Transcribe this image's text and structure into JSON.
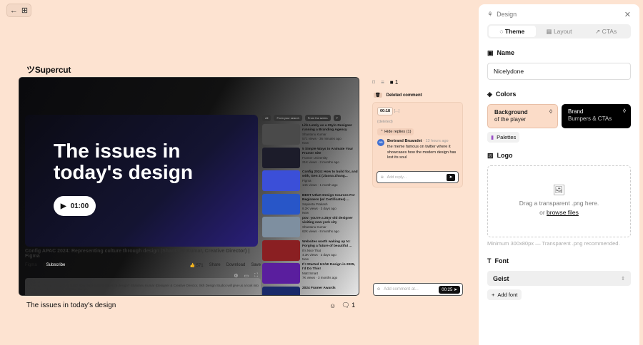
{
  "topbar": {
    "back_icon": "←",
    "grid_icon": "⊞"
  },
  "brand": {
    "logo_mark": "ツ",
    "name": "Supercut"
  },
  "video": {
    "title_overlay": "The issues in today's design",
    "play_time": "01:00",
    "yt_title": "Config APAC 2024: Representing culture through design (Shantanu Kumar, Creative Director) | Figma",
    "channel": "Figma",
    "subscribe": "Subscribe",
    "likes": "571",
    "share": "Share",
    "download": "Download",
    "save": "Save",
    "views": "8K views  4 months ago",
    "description": "How does design influence culture? How does culture influence design? Shantanu Kumar (Designer & Creative Director, Skh Design Studio) will give us a look into the details of the craft behind great design.",
    "more": "...more",
    "chips": [
      "All",
      "From your search",
      "From the series",
      "F"
    ],
    "related": [
      {
        "title": "Life Lately as a 25y/o Designer running a Branding Agency",
        "channel": "Shantanu Kumar",
        "meta": "571 views · 36 minutes ago",
        "badge": "New",
        "dur": "14:10",
        "color": "#4a4a4a"
      },
      {
        "title": "5 Simple Ways to Animate Your Framer Site",
        "channel": "Framer University",
        "meta": "21K views · 2 months ago",
        "badge": "",
        "dur": "14:41",
        "color": "#1c1c2a"
      },
      {
        "title": "Config 2024: How to build for, and with, Gen Z (Jiaona Zhang...",
        "channel": "Figma",
        "meta": "14K views · 1 month ago",
        "badge": "",
        "dur": "23:15",
        "color": "#3b4fd8"
      },
      {
        "title": "BEST UI/UX Design Courses For Beginners (w/ Certificates) ...",
        "channel": "Sapienta Prakash",
        "meta": "8.2K views · 3 days ago",
        "badge": "New",
        "dur": "10:28",
        "color": "#2856c8"
      },
      {
        "title": "pov: you're a 25yr old designer visiting new york city",
        "channel": "Shantanu Kumar",
        "meta": "62K views · 8 months ago",
        "badge": "",
        "dur": "14:01",
        "color": "#7e8fa0"
      },
      {
        "title": "Websites worth waking up to: Forging a future of beautiful ...",
        "channel": "It's Nice That",
        "meta": "4.3K views · 2 days ago",
        "badge": "New",
        "dur": "19:05",
        "color": "#8a1f22"
      },
      {
        "title": "If I Started UX/UI Design in 2025, I'd Do This!",
        "channel": "Matt Smart",
        "meta": "7K views · 3 months ago",
        "badge": "",
        "dur": "",
        "color": "#5a1e9e"
      },
      {
        "title": "2024 Framer Awards",
        "channel": "",
        "meta": "",
        "badge": "",
        "dur": "",
        "color": "#1a2a6a"
      }
    ]
  },
  "caption": {
    "title": "The issues in today's design",
    "comment_count": "1"
  },
  "comments": {
    "tab_count": "1",
    "header": "Deleted comment",
    "timestamp": "00:18",
    "ellipsis": "[...]",
    "deleted": "(deleted)",
    "hide_replies": "Hide replies (1)",
    "reply": {
      "initials": "BB",
      "author": "Bertrand Bruandet",
      "time": "· 13 hours ago",
      "text": "the meme famous on twitter where it showcases how the modern design has lost its soul"
    },
    "reply_placeholder": "Add reply...",
    "add_placeholder": "Add comment at...",
    "add_time": "00:25"
  },
  "panel": {
    "title": "Design",
    "tabs": [
      "Theme",
      "Layout",
      "CTAs"
    ],
    "name_label": "Name",
    "name_value": "Nicelydone",
    "colors_label": "Colors",
    "bg_title": "Background",
    "bg_sub": "of the player",
    "bg_color": "#fbdcc8",
    "brand_title": "Brand",
    "brand_sub": "Bumpers & CTAs",
    "brand_color": "#000000",
    "palettes": "Palettes",
    "logo_label": "Logo",
    "drop_text": "Drag a transparent .png here.",
    "drop_or": "or ",
    "browse": "browse files",
    "hint": "Minimum 300x80px — Transparent .png recommended.",
    "font_label": "Font",
    "font_value": "Geist",
    "add_font": "Add font"
  }
}
